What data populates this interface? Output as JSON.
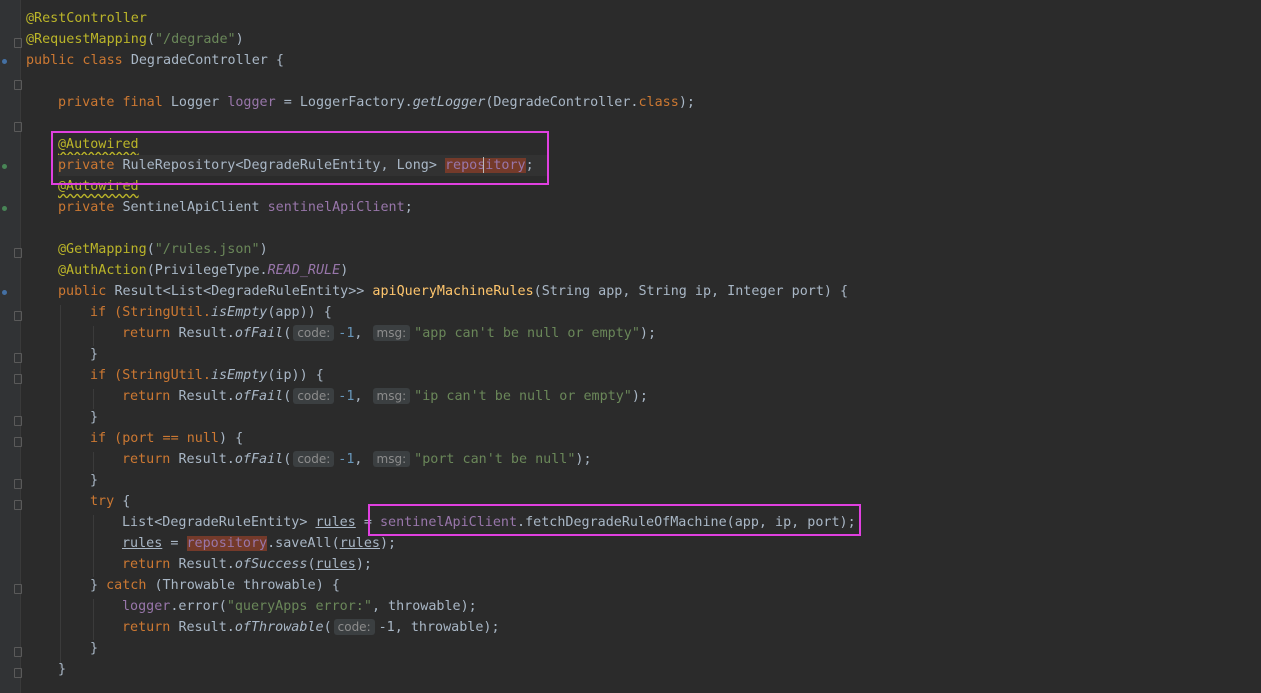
{
  "editor": {
    "file_lines": {
      "rest_controller": "@RestController",
      "request_mapping_ann": "@RequestMapping",
      "request_mapping_path": "\"/degrade\"",
      "class_decl_kw": "public class ",
      "class_name": "DegradeController",
      "logger_kw": "private final ",
      "logger_type": "Logger ",
      "logger_field": "logger",
      "logger_init": "LoggerFactory.",
      "logger_method": "getLogger",
      "logger_arg": "(DegradeController.",
      "logger_class_kw": "class",
      "autowired1": "@Autowired",
      "repo_kw": "private ",
      "repo_type": "RuleRepository<DegradeRuleEntity, Long> ",
      "repo_field": "repository",
      "autowired2": "@Autowired",
      "client_kw": "private ",
      "client_type": "SentinelApiClient ",
      "client_field": "sentinelApiClient",
      "get_mapping_ann": "@GetMapping",
      "get_mapping_path": "\"/rules.json\"",
      "auth_action_ann": "@AuthAction",
      "auth_action_arg": "PrivilegeType.",
      "auth_action_const": "READ_RULE",
      "method_kw": "public ",
      "method_ret": "Result<List<DegradeRuleEntity>> ",
      "method_name": "apiQueryMachineRules",
      "method_params": "(String app, String ip, Integer port) {",
      "if1": "if (StringUtil.",
      "is_empty": "isEmpty",
      "if1_arg": "(app)) {",
      "return_kw": "return ",
      "result_cls": "Result.",
      "of_fail": "ofFail",
      "hint_code": "code:",
      "hint_msg": "msg:",
      "neg_one": "-1",
      "msg1": "\"app can't be null or empty\"",
      "if2_arg": "(ip)) {",
      "msg2": "\"ip can't be null or empty\"",
      "if3": "if (port == ",
      "null_kw": "null",
      "msg3": "\"port can't be null\"",
      "try_kw": "try",
      "list_decl": "List<DegradeRuleEntity> ",
      "rules_var": "rules",
      "fetch_call": ".fetchDegradeRuleOfMachine(app, ip, port);",
      "save_all": ".saveAll(",
      "of_success": "ofSuccess",
      "catch_kw": "catch",
      "catch_arg": " (Throwable throwable) {",
      "logger_error": ".error(",
      "error_msg": "\"queryApps error:\"",
      "throwable_arg": ", throwable);",
      "of_throwable": "ofThrowable",
      "throwable_end": "-1, throwable);"
    }
  }
}
